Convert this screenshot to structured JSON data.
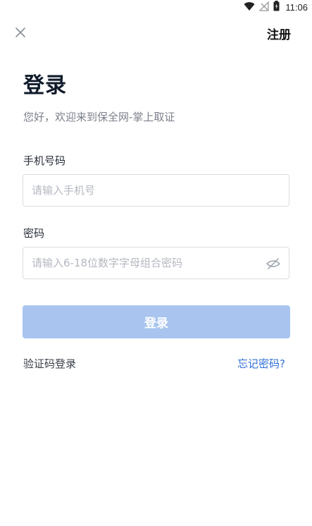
{
  "status_bar": {
    "time": "11:06",
    "icons": [
      "wifi-icon",
      "no-signal-icon",
      "battery-icon"
    ]
  },
  "nav": {
    "close_icon": "close-icon",
    "register_label": "注册"
  },
  "header": {
    "title": "登录",
    "subtitle": "您好，欢迎来到保全网-掌上取证"
  },
  "form": {
    "phone_label": "手机号码",
    "phone_value": "",
    "phone_placeholder": "请输入手机号",
    "password_label": "密码",
    "password_value": "",
    "password_placeholder": "请输入6-18位数字字母组合密码",
    "password_toggle_icon": "eye-off-icon",
    "login_button": "登录"
  },
  "links": {
    "sms_login": "验证码登录",
    "forgot_password": "忘记密码?"
  },
  "colors": {
    "primary_disabled": "#a9c5ef",
    "link": "#2f6fd6",
    "title": "#0f1a2a",
    "subtitle": "#7b808a"
  }
}
